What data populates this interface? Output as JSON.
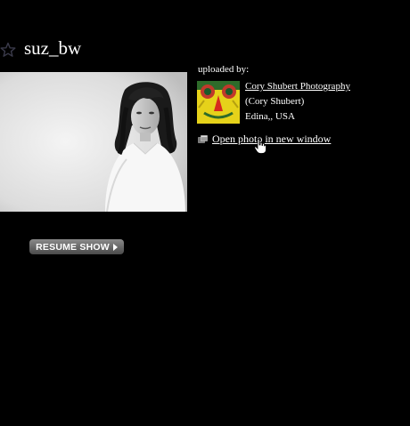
{
  "photo": {
    "title": "suz_bw"
  },
  "uploader": {
    "label": "uploaded by:",
    "name": "Cory Shubert Photography",
    "real_name": "(Cory Shubert)",
    "location": "Edina,, USA"
  },
  "actions": {
    "open_new_window": "Open photo in new window",
    "resume_show": "RESUME SHOW"
  },
  "icons": {
    "favorite": "star-outline-icon",
    "open_window": "window-icon",
    "resume": "play-icon",
    "cursor": "hand-cursor-icon"
  },
  "colors": {
    "background": "#000000",
    "text": "#ffffff",
    "button_top": "#8a8a8a",
    "button_bottom": "#4a4a4a"
  }
}
